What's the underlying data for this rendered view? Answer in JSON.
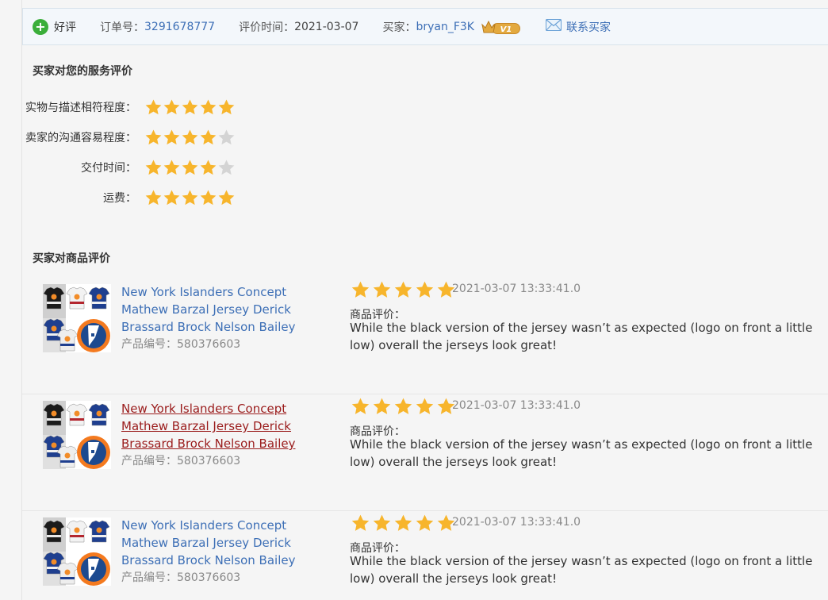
{
  "header": {
    "rating_label": "好评",
    "order_label": "订单号：",
    "order_value": "3291678777",
    "time_label": "评价时间：",
    "time_value": "2021-03-07",
    "buyer_label": "买家：",
    "buyer_value": "bryan_F3K",
    "vip_badge": "V1",
    "contact_label": "联系买家"
  },
  "service": {
    "title": "买家对您的服务评价",
    "rows": [
      {
        "label": "实物与描述相符程度：",
        "stars": 5
      },
      {
        "label": "卖家的沟通容易程度：",
        "stars": 4
      },
      {
        "label": "交付时间：",
        "stars": 4
      },
      {
        "label": "运费：",
        "stars": 5
      }
    ]
  },
  "product": {
    "title": "买家对商品评价",
    "items": [
      {
        "name": "New York Islanders Concept Mathew Barzal Jersey Derick Brassard Brock Nelson Bailey",
        "code_label": "产品编号：",
        "code": "580376603",
        "stars": 5,
        "time": "2021-03-07 13:33:41.0",
        "review_label": "商品评价：",
        "review": "While the black version of the jersey wasn’t as expected (logo on front a little low) overall the jerseys look great!"
      },
      {
        "name": "New York Islanders Concept Mathew Barzal Jersey Derick Brassard Brock Nelson Bailey",
        "code_label": "产品编号：",
        "code": "580376603",
        "stars": 5,
        "time": "2021-03-07 13:33:41.0",
        "review_label": "商品评价：",
        "review": "While the black version of the jersey wasn’t as expected (logo on front a little low) overall the jerseys look great!"
      },
      {
        "name": "New York Islanders Concept Mathew Barzal Jersey Derick Brassard Brock Nelson Bailey",
        "code_label": "产品编号：",
        "code": "580376603",
        "stars": 5,
        "time": "2021-03-07 13:33:41.0",
        "review_label": "商品评价：",
        "review": "While the black version of the jersey wasn’t as expected (logo on front a little low) overall the jerseys look great!"
      }
    ]
  },
  "colors": {
    "star_on": "#f7b52c",
    "star_off": "#d4d4d4",
    "link": "#3d6fb6",
    "link_hover": "#9a1b1b"
  },
  "icons": [
    "plus-circle-icon",
    "crown-icon",
    "mail-icon",
    "star-icon"
  ]
}
